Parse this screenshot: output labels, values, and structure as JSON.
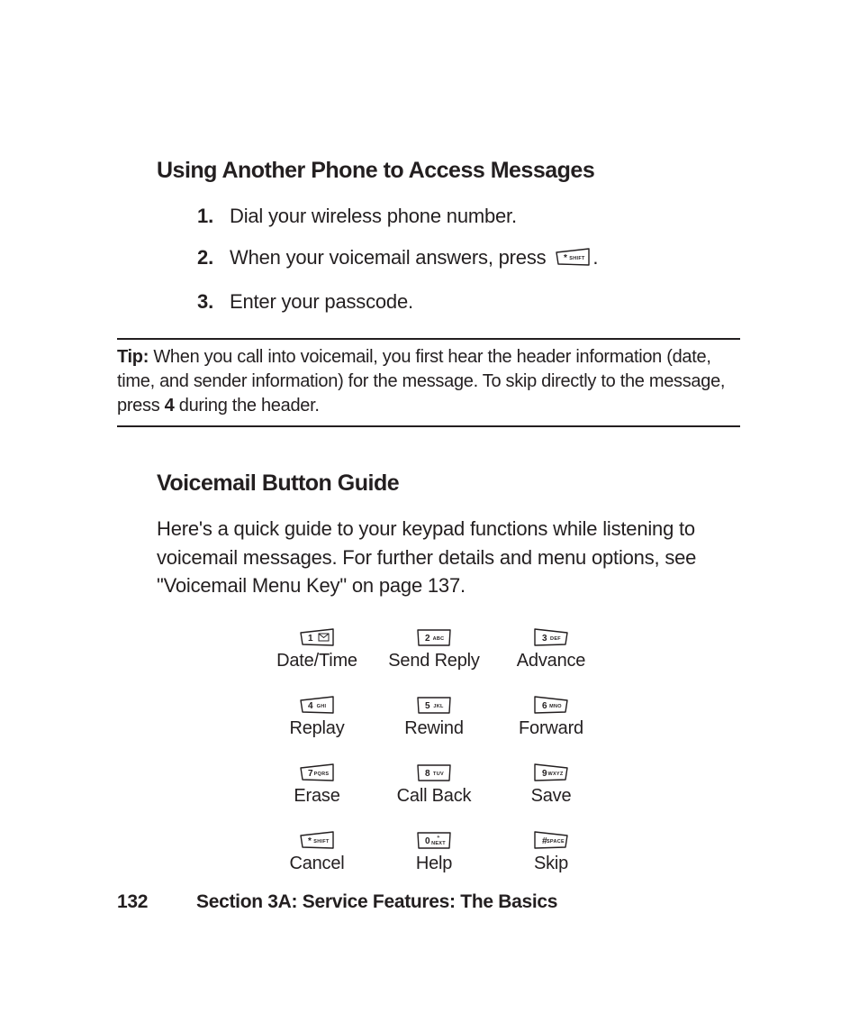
{
  "headings": {
    "access": "Using Another Phone to Access Messages",
    "guide": "Voicemail Button Guide"
  },
  "steps": [
    {
      "num": "1.",
      "text": "Dial your wireless phone number."
    },
    {
      "num": "2.",
      "text_before": "When your voicemail answers, press ",
      "key": {
        "digit": "*",
        "sub": "SHIFT",
        "lean": "left"
      },
      "text_after": "."
    },
    {
      "num": "3.",
      "text": "Enter your passcode."
    }
  ],
  "tip": {
    "label": "Tip:",
    "text_a": " When you call into voicemail, you first hear the header information (date, time, and sender information) for the message. To skip directly to the message, press ",
    "bold": "4",
    "text_b": " during the header."
  },
  "guide_intro": "Here's a quick guide to your keypad functions while listening to voicemail messages. For further details and menu options, see \"Voicemail Menu Key\" on page 137.",
  "keypad": [
    {
      "digit": "1",
      "sub": "",
      "icon": "envelope",
      "lean": "left",
      "label": "Date/Time"
    },
    {
      "digit": "2",
      "sub": "ABC",
      "lean": "center",
      "label": "Send Reply"
    },
    {
      "digit": "3",
      "sub": "DEF",
      "lean": "right",
      "label": "Advance"
    },
    {
      "digit": "4",
      "sub": "GHI",
      "lean": "left",
      "label": "Replay"
    },
    {
      "digit": "5",
      "sub": "JKL",
      "lean": "center",
      "label": "Rewind"
    },
    {
      "digit": "6",
      "sub": "MNO",
      "lean": "right",
      "label": "Forward"
    },
    {
      "digit": "7",
      "sub": "PQRS",
      "lean": "left",
      "label": "Erase"
    },
    {
      "digit": "8",
      "sub": "TUV",
      "lean": "center",
      "label": "Call Back"
    },
    {
      "digit": "9",
      "sub": "WXYZ",
      "lean": "right",
      "label": "Save"
    },
    {
      "digit": "*",
      "sub": "SHIFT",
      "lean": "left",
      "label": "Cancel"
    },
    {
      "digit": "0",
      "sub": "NEXT",
      "plus": true,
      "lean": "center",
      "label": "Help"
    },
    {
      "digit": "#",
      "sub": "SPACE",
      "lean": "right",
      "label": "Skip"
    }
  ],
  "footer": {
    "page": "132",
    "section": "Section 3A: Service Features: The Basics"
  }
}
